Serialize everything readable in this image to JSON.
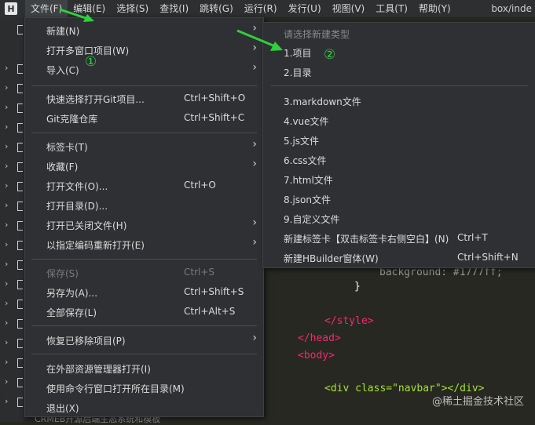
{
  "menubar": {
    "app_icon": "H",
    "items": [
      {
        "label": "文件(F)",
        "active": true
      },
      {
        "label": "编辑(E)"
      },
      {
        "label": "选择(S)"
      },
      {
        "label": "查找(I)"
      },
      {
        "label": "跳转(G)"
      },
      {
        "label": "运行(R)"
      },
      {
        "label": "发行(U)"
      },
      {
        "label": "视图(V)"
      },
      {
        "label": "工具(T)"
      },
      {
        "label": "帮助(Y)"
      }
    ],
    "window_title": "box/inde"
  },
  "file_menu": {
    "items": [
      {
        "label": "新建(N)",
        "shortcut": "",
        "submenu": true
      },
      {
        "label": "打开多窗口项目(W)",
        "shortcut": "",
        "submenu": true
      },
      {
        "label": "导入(C)",
        "shortcut": "",
        "submenu": true
      },
      {
        "label": "快速选择打开Git项目...",
        "shortcut": "Ctrl+Shift+O"
      },
      {
        "label": "Git克隆仓库",
        "shortcut": "Ctrl+Shift+C"
      },
      {
        "label": "标签卡(T)",
        "shortcut": "",
        "submenu": true
      },
      {
        "label": "收藏(F)",
        "shortcut": "",
        "submenu": true
      },
      {
        "label": "打开文件(O)...",
        "shortcut": "Ctrl+O"
      },
      {
        "label": "打开目录(D)...",
        "shortcut": ""
      },
      {
        "label": "打开已关闭文件(H)",
        "shortcut": "",
        "submenu": true
      },
      {
        "label": "以指定编码重新打开(E)",
        "shortcut": "",
        "submenu": true
      },
      {
        "label": "保存(S)",
        "shortcut": "Ctrl+S",
        "disabled": true
      },
      {
        "label": "另存为(A)...",
        "shortcut": "Ctrl+Shift+S"
      },
      {
        "label": "全部保存(L)",
        "shortcut": "Ctrl+Alt+S"
      },
      {
        "label": "恢复已移除项目(P)",
        "shortcut": "",
        "submenu": true
      },
      {
        "label": "在外部资源管理器打开(I)",
        "shortcut": ""
      },
      {
        "label": "使用命令行窗口打开所在目录(M)",
        "shortcut": ""
      },
      {
        "label": "退出(X)",
        "shortcut": ""
      }
    ]
  },
  "new_submenu": {
    "header": "请选择新建类型",
    "items": [
      {
        "label": "1.项目",
        "shortcut": ""
      },
      {
        "label": "2.目录",
        "shortcut": ""
      },
      {
        "label": "3.markdown文件",
        "shortcut": ""
      },
      {
        "label": "4.vue文件",
        "shortcut": ""
      },
      {
        "label": "5.js文件",
        "shortcut": ""
      },
      {
        "label": "6.css文件",
        "shortcut": ""
      },
      {
        "label": "7.html文件",
        "shortcut": ""
      },
      {
        "label": "8.json文件",
        "shortcut": ""
      },
      {
        "label": "9.自定义文件",
        "shortcut": ""
      },
      {
        "label": "新建标签卡【双击标签卡右侧空白】(N)",
        "shortcut": "Ctrl+T"
      },
      {
        "label": "新建HBuilder窗体(W)",
        "shortcut": "Ctrl+Shift+N"
      }
    ]
  },
  "editor": {
    "lines": {
      "background": "background: #1777ff;",
      "brace": "}",
      "style_close": "</style>",
      "head_close": "</head>",
      "body_open": "<body>",
      "div_navbar": "<div class=\"navbar\"></div>"
    }
  },
  "bottom_file": "CRMEB开源后端生态系统和模板",
  "annotations": {
    "step1": "①",
    "step2": "②"
  },
  "watermark": "@稀土掘金技术社区",
  "colors": {
    "accent_green": "#2fcf3f",
    "menu_bg": "#2e3033",
    "editor_bg": "#272822"
  }
}
